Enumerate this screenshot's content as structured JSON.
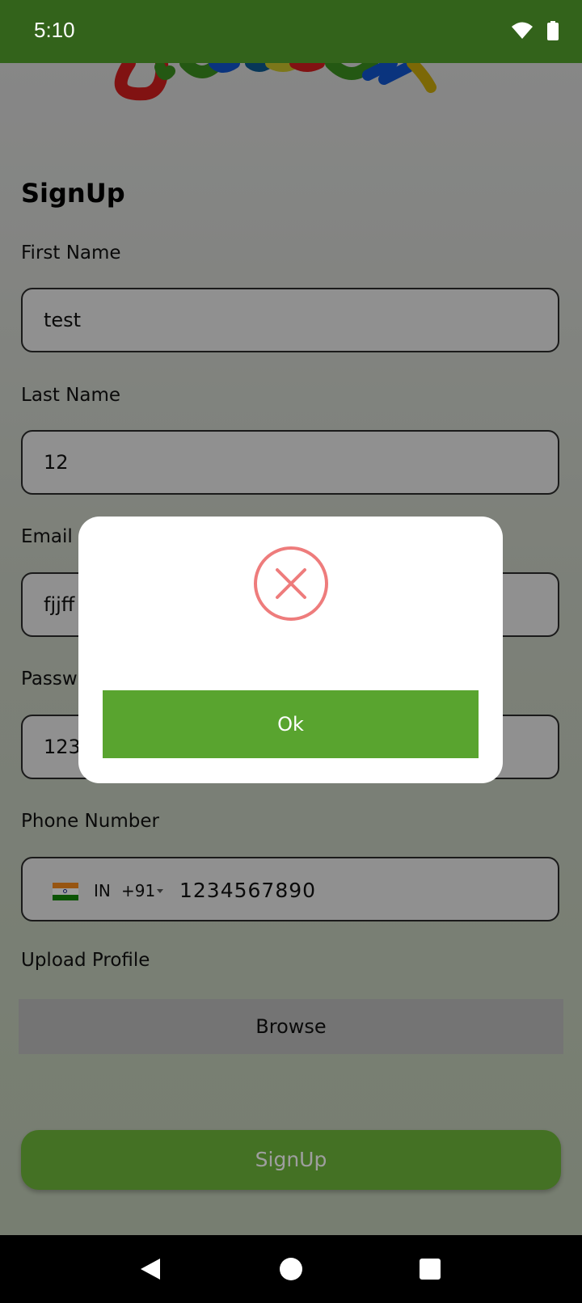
{
  "status": {
    "time": "5:10"
  },
  "form": {
    "title": "SignUp",
    "first_name_label": "First Name",
    "first_name_value": "test",
    "last_name_label": "Last Name",
    "last_name_value": "12",
    "email_label": "Email",
    "email_value": "fjjff",
    "password_label": "Passw",
    "password_value": "123",
    "phone_label": "Phone Number",
    "country_code": "IN",
    "dial_code": "+91",
    "phone_value": "1234567890",
    "upload_label": "Upload Profile",
    "browse_label": "Browse",
    "submit_label": "SignUp"
  },
  "dialog": {
    "icon": "error-x-icon",
    "ok_label": "Ok"
  },
  "colors": {
    "status_bar": "#33631b",
    "primary": "#6fb73a",
    "dialog_button": "#59a42f",
    "error": "#ee7c7c"
  }
}
